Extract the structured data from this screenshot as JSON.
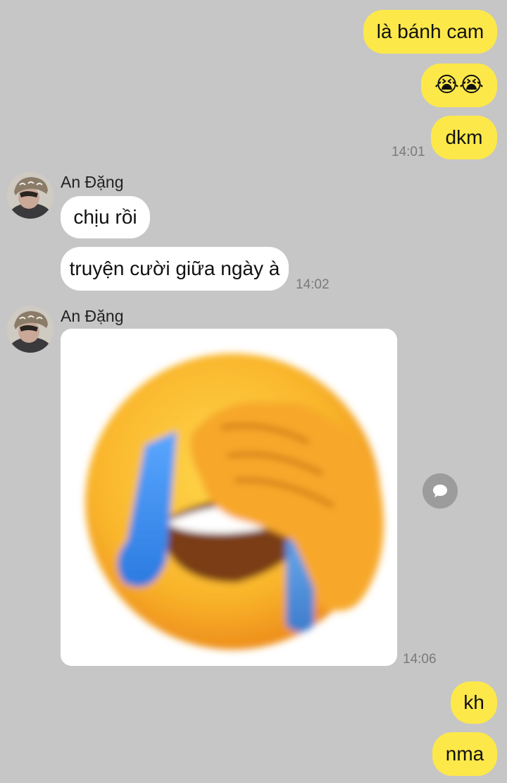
{
  "contact": {
    "name": "An Đặng"
  },
  "messages": {
    "m1": {
      "text": "là bánh cam"
    },
    "m2": {
      "emoji": "😭😭"
    },
    "m3": {
      "text": "dkm",
      "time": "14:01"
    },
    "m4": {
      "text": "chịu rồi"
    },
    "m5": {
      "text": "truyện cười giữa ngày à",
      "time": "14:02"
    },
    "m6": {
      "image": "facepalm-crying-emoji-sticker",
      "time": "14:06"
    },
    "m7": {
      "text": "kh"
    },
    "m8": {
      "text": "nma"
    }
  },
  "icons": {
    "share": "share-bubble-icon"
  },
  "colors": {
    "background": "#c6c6c6",
    "outgoing_bubble": "#fde84a",
    "incoming_bubble": "#ffffff",
    "timestamp": "#7a7a7a"
  }
}
